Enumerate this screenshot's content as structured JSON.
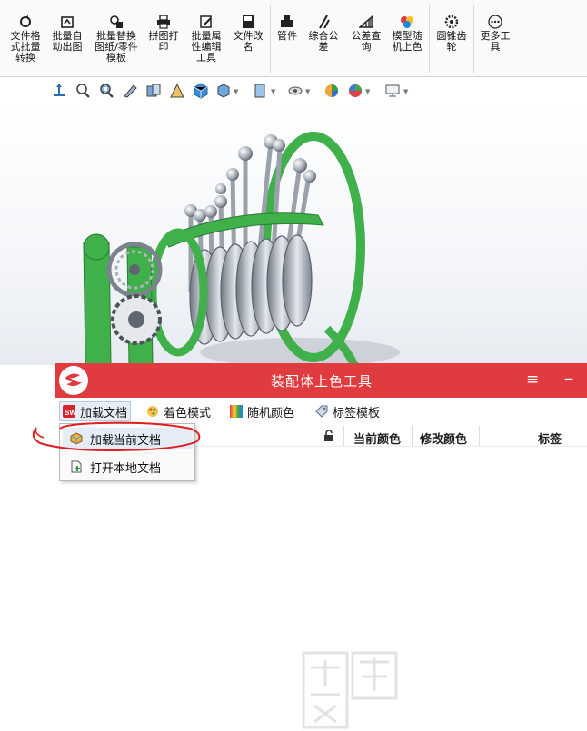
{
  "ribbon": {
    "buttons": [
      {
        "label": "文件格\n式批量\n转换",
        "icon": "file-convert-icon"
      },
      {
        "label": "批量自\n动出图",
        "icon": "batch-drawing-icon"
      },
      {
        "label": "批量替换\n图纸/零件\n模板",
        "icon": "replace-template-icon"
      },
      {
        "label": "拼图打\n印",
        "icon": "printer-icon"
      },
      {
        "label": "批量属\n性编辑\n工具",
        "icon": "edit-properties-icon"
      },
      {
        "label": "文件改\n名",
        "icon": "save-rename-icon"
      },
      {
        "label": "管件",
        "icon": "pipe-fitting-icon"
      },
      {
        "label": "综合公\n差",
        "icon": "tolerance-icon"
      },
      {
        "label": "公差查\n询",
        "icon": "tolerance-lookup-icon"
      },
      {
        "label": "模型随\n机上色",
        "icon": "random-color-icon"
      },
      {
        "label": "圆锥齿\n轮",
        "icon": "bevel-gear-icon"
      },
      {
        "label": "更多工\n具",
        "icon": "more-tools-icon"
      }
    ]
  },
  "viewbar": {
    "icons": [
      "view-orientation-icon",
      "zoom-to-fit-icon",
      "zoom-area-icon",
      "previous-view-icon",
      "section-view-icon",
      "dynamic-annotation-icon",
      "view-cube-icon",
      "display-style-icon",
      "hide-show-icon",
      "edit-appearance-icon",
      "apply-scene-icon",
      "view-settings-icon",
      "monitor-icon"
    ]
  },
  "panel": {
    "title": "装配体上色工具",
    "menu_icon": "≡",
    "minimize": "‒",
    "toolbar": [
      {
        "label": "加载文档",
        "icon": "sw-logo-icon"
      },
      {
        "label": "着色模式",
        "icon": "palette-icon"
      },
      {
        "label": "随机颜色",
        "icon": "gradient-icon"
      },
      {
        "label": "标签模板",
        "icon": "tag-icon"
      }
    ],
    "grid": {
      "columns": [
        "当前颜色",
        "修改颜色",
        "标签"
      ],
      "lock_icon": "lock-icon"
    },
    "dropdown": [
      {
        "label": "加载当前文档",
        "icon": "cube-icon"
      },
      {
        "label": "打开本地文档",
        "icon": "open-file-icon"
      }
    ]
  },
  "colors": {
    "titlebar": "#e03b3f",
    "model_green": "#3fb04a",
    "annotation_red": "#e02020"
  }
}
